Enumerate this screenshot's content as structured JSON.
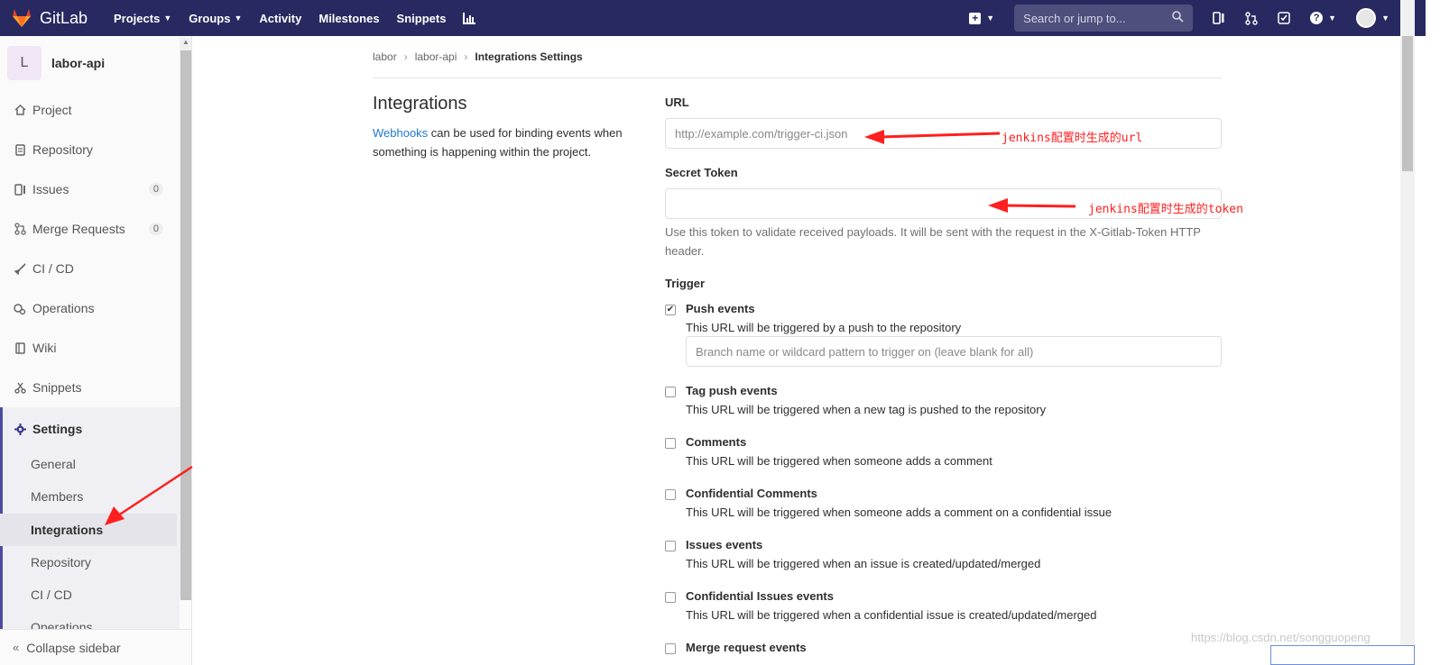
{
  "navbar": {
    "brand": "GitLab",
    "links": [
      {
        "label": "Projects",
        "dropdown": true
      },
      {
        "label": "Groups",
        "dropdown": true
      },
      {
        "label": "Activity",
        "dropdown": false
      },
      {
        "label": "Milestones",
        "dropdown": false
      },
      {
        "label": "Snippets",
        "dropdown": false
      }
    ],
    "search_placeholder": "Search or jump to...",
    "colors": {
      "background": "#292961"
    }
  },
  "sidebar": {
    "project_initial": "L",
    "project_name": "labor-api",
    "items": [
      {
        "label": "Project",
        "icon": "home-icon"
      },
      {
        "label": "Repository",
        "icon": "doc-icon"
      },
      {
        "label": "Issues",
        "icon": "issues-icon",
        "count": "0"
      },
      {
        "label": "Merge Requests",
        "icon": "merge-icon",
        "count": "0"
      },
      {
        "label": "CI / CD",
        "icon": "rocket-icon"
      },
      {
        "label": "Operations",
        "icon": "cloud-gear-icon"
      },
      {
        "label": "Wiki",
        "icon": "book-icon"
      },
      {
        "label": "Snippets",
        "icon": "scissors-icon"
      },
      {
        "label": "Settings",
        "icon": "gear-icon"
      }
    ],
    "settings_sub": [
      "General",
      "Members",
      "Integrations",
      "Repository",
      "CI / CD",
      "Operations"
    ],
    "collapse_label": "Collapse sidebar"
  },
  "breadcrumb": {
    "items": [
      "labor",
      "labor-api"
    ],
    "current": "Integrations Settings"
  },
  "main": {
    "title": "Integrations",
    "desc_link": "Webhooks",
    "desc_text": " can be used for binding events when something is happening within the project.",
    "url_label": "URL",
    "url_placeholder": "http://example.com/trigger-ci.json",
    "token_label": "Secret Token",
    "token_help": "Use this token to validate received payloads. It will be sent with the request in the X-Gitlab-Token HTTP header.",
    "trigger_label": "Trigger",
    "triggers": [
      {
        "title": "Push events",
        "desc": "This URL will be triggered by a push to the repository",
        "checked": true,
        "input_placeholder": "Branch name or wildcard pattern to trigger on (leave blank for all)"
      },
      {
        "title": "Tag push events",
        "desc": "This URL will be triggered when a new tag is pushed to the repository",
        "checked": false
      },
      {
        "title": "Comments",
        "desc": "This URL will be triggered when someone adds a comment",
        "checked": false
      },
      {
        "title": "Confidential Comments",
        "desc": "This URL will be triggered when someone adds a comment on a confidential issue",
        "checked": false
      },
      {
        "title": "Issues events",
        "desc": "This URL will be triggered when an issue is created/updated/merged",
        "checked": false
      },
      {
        "title": "Confidential Issues events",
        "desc": "This URL will be triggered when a confidential issue is created/updated/merged",
        "checked": false
      },
      {
        "title": "Merge request events",
        "desc": "",
        "checked": false
      }
    ]
  },
  "annotations": {
    "url_note": "jenkins配置时生成的url",
    "token_note": "jenkins配置时生成的token",
    "color": "#ff1f1f"
  },
  "watermark": "https://blog.csdn.net/songguopeng"
}
